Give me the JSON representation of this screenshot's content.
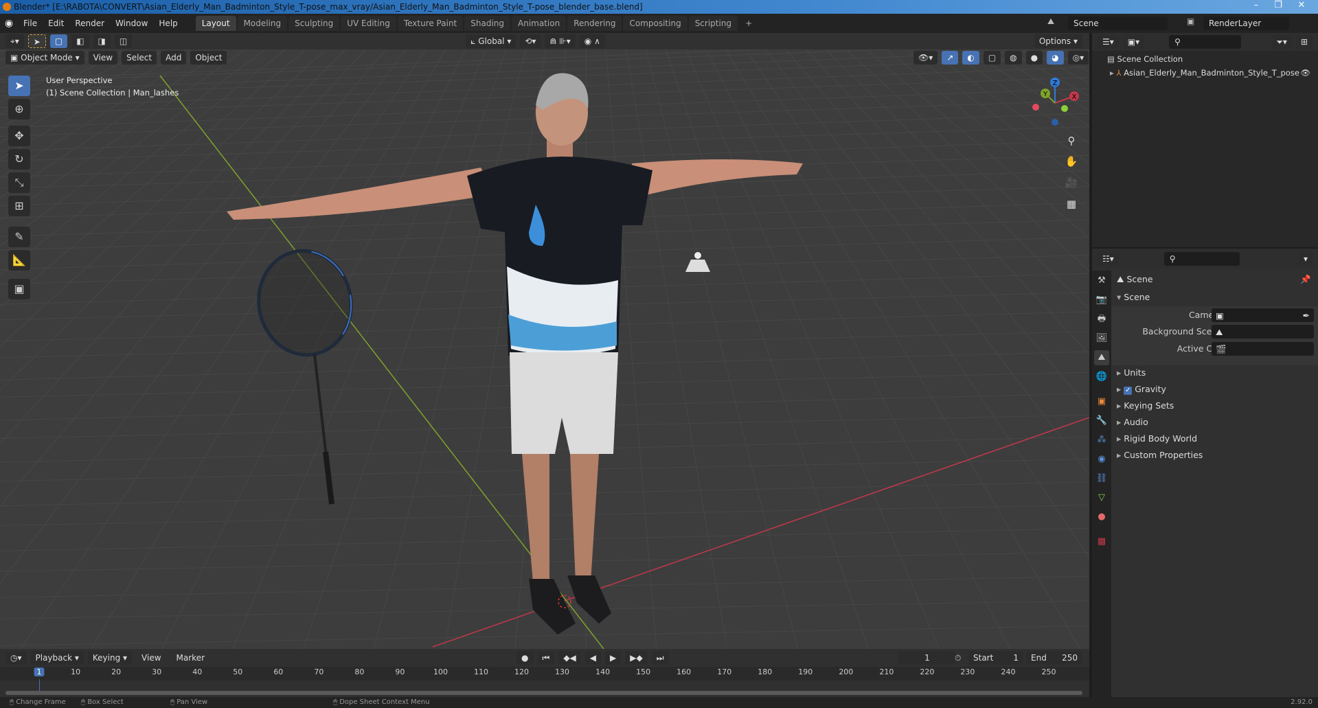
{
  "window": {
    "title": "Blender* [E:\\RABOTA\\CONVERT\\Asian_Elderly_Man_Badminton_Style_T-pose_max_vray/Asian_Elderly_Man_Badminton_Style_T-pose_blender_base.blend]",
    "minimize": "–",
    "restore": "❐",
    "close": "✕"
  },
  "menu": [
    "File",
    "Edit",
    "Render",
    "Window",
    "Help"
  ],
  "workspaces": [
    {
      "label": "Layout",
      "active": true
    },
    {
      "label": "Modeling"
    },
    {
      "label": "Sculpting"
    },
    {
      "label": "UV Editing"
    },
    {
      "label": "Texture Paint"
    },
    {
      "label": "Shading"
    },
    {
      "label": "Animation"
    },
    {
      "label": "Rendering"
    },
    {
      "label": "Compositing"
    },
    {
      "label": "Scripting"
    },
    {
      "label": "+"
    }
  ],
  "scene_selector": "Scene",
  "view_layer": "RenderLayer",
  "viewport": {
    "transform_orientation": "Global",
    "options": "Options",
    "mode": "Object Mode",
    "menus": [
      "View",
      "Select",
      "Add",
      "Object"
    ],
    "overlay_title": "User Perspective",
    "overlay_subtitle": "(1) Scene Collection | Man_lashes",
    "axes": {
      "x": "X",
      "y": "Y",
      "z": "Z"
    },
    "colors": {
      "background": "#3d3d3d",
      "x_axis": "#c4384a",
      "y_axis": "#7fa32c",
      "accent": "#4772b3"
    }
  },
  "outliner": {
    "root": "Scene Collection",
    "items": [
      {
        "label": "Asian_Elderly_Man_Badminton_Style_T_pose",
        "visible": true
      }
    ]
  },
  "properties": {
    "context": "Scene",
    "panel": "Scene",
    "fields": [
      {
        "label": "Camera",
        "value": ""
      },
      {
        "label": "Background Scene",
        "value": ""
      },
      {
        "label": "Active Clip",
        "value": ""
      }
    ],
    "subpanels": [
      {
        "label": "Units"
      },
      {
        "label": "Gravity",
        "checked": true
      },
      {
        "label": "Keying Sets"
      },
      {
        "label": "Audio"
      },
      {
        "label": "Rigid Body World"
      },
      {
        "label": "Custom Properties"
      }
    ]
  },
  "timeline": {
    "menus": [
      "Playback",
      "Keying",
      "View",
      "Marker"
    ],
    "current_frame": "1",
    "start_label": "Start",
    "start": "1",
    "end_label": "End",
    "end": "250",
    "ticks": [
      "1",
      "10",
      "20",
      "30",
      "40",
      "50",
      "60",
      "70",
      "80",
      "90",
      "100",
      "110",
      "120",
      "130",
      "140",
      "150",
      "160",
      "170",
      "180",
      "190",
      "200",
      "210",
      "220",
      "230",
      "240",
      "250"
    ]
  },
  "statusbar": {
    "items": [
      "Change Frame",
      "Box Select",
      "Pan View",
      "Dope Sheet Context Menu"
    ],
    "version": "2.92.0"
  }
}
